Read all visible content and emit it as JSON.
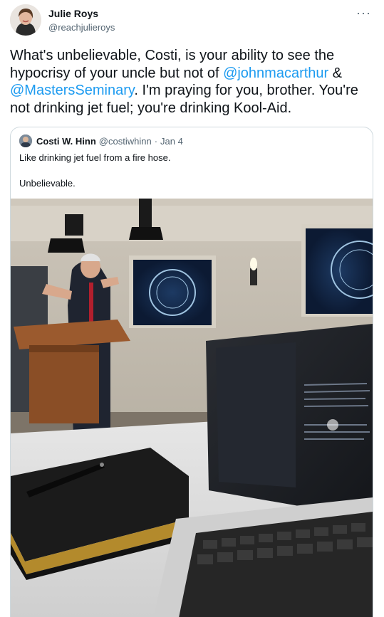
{
  "tweet": {
    "author_name": "Julie Roys",
    "author_handle": "@reachjulieroys",
    "more_label": "···",
    "text_part1": "What's unbelievable, Costi, is your ability to see the hypocrisy of your uncle but not of ",
    "mention1": "@johnmacarthur",
    "text_part2": " & ",
    "mention2": "@MastersSeminary",
    "text_part3": ". I'm praying for you, brother. You're not drinking jet fuel; you're drinking Kool-Aid."
  },
  "quote": {
    "author_name": "Costi W. Hinn",
    "author_handle": "@costiwhinn",
    "separator": "·",
    "date": "Jan 4",
    "line1": "Like drinking jet fuel from a fire hose.",
    "line2": "Unbelievable."
  },
  "colors": {
    "link": "#1d9bf0",
    "text": "#0f1419",
    "muted": "#536471",
    "border": "#cfd9de"
  },
  "icons": {
    "more": "more-dots-icon"
  }
}
